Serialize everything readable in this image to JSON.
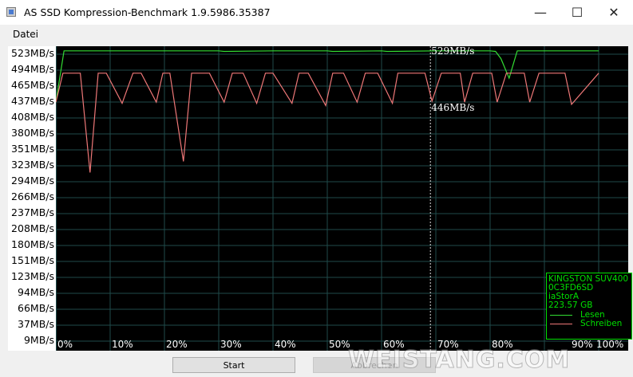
{
  "window": {
    "title": "AS SSD Kompression-Benchmark 1.9.5986.35387",
    "minimize_glyph": "—",
    "maximize_glyph": "☐",
    "close_glyph": "✕"
  },
  "menu": {
    "items": [
      "Datei"
    ]
  },
  "chart_data": {
    "type": "line",
    "y_tick_labels": [
      "523MB/s",
      "494MB/s",
      "465MB/s",
      "437MB/s",
      "408MB/s",
      "380MB/s",
      "351MB/s",
      "323MB/s",
      "294MB/s",
      "266MB/s",
      "237MB/s",
      "208MB/s",
      "180MB/s",
      "151MB/s",
      "123MB/s",
      "94MB/s",
      "66MB/s",
      "37MB/s",
      "9MB/s"
    ],
    "x_tick_labels": [
      "0%",
      "10%",
      "20%",
      "30%",
      "40%",
      "50%",
      "60%",
      "70%",
      "80%",
      "90%",
      "100%"
    ],
    "x_unit": "%",
    "y_unit": "MB/s",
    "xlim": [
      0,
      100
    ],
    "ylim": [
      0,
      537
    ],
    "grid": true,
    "legend_placement": "bottom-right",
    "cursor_x": 69,
    "series": [
      {
        "name": "Lesen",
        "color": "#33dd33",
        "x": [
          0,
          1.5,
          30,
          31,
          40,
          50,
          51,
          60,
          61,
          70,
          80,
          81,
          82,
          83.5,
          85,
          100
        ],
        "y": [
          437,
          529,
          529,
          528,
          529,
          529,
          528,
          529,
          528,
          529,
          529,
          528,
          515,
          480,
          529,
          529
        ]
      },
      {
        "name": "Schreiben",
        "color": "#ee7777",
        "x": [
          0,
          1.3,
          4.5,
          6.3,
          7.8,
          9.3,
          12.2,
          14.2,
          15.7,
          18.5,
          19.7,
          21,
          23.5,
          25,
          26.5,
          28.3,
          31,
          32.5,
          34.5,
          37,
          38.6,
          40,
          43.5,
          44.8,
          46.5,
          49.7,
          51,
          53,
          55.5,
          57,
          59.3,
          62,
          63,
          65,
          68,
          69.3,
          71,
          74.5,
          75.3,
          76.8,
          80.3,
          81.3,
          83,
          86.3,
          87.3,
          89,
          93.8,
          95,
          100
        ],
        "y": [
          437,
          489,
          489,
          311,
          489,
          489,
          435,
          489,
          489,
          437,
          489,
          489,
          331,
          489,
          489,
          489,
          437,
          489,
          489,
          435,
          489,
          489,
          435,
          489,
          489,
          431,
          489,
          489,
          437,
          489,
          489,
          435,
          489,
          489,
          489,
          439,
          489,
          489,
          437,
          489,
          489,
          437,
          489,
          489,
          437,
          489,
          489,
          433,
          489
        ]
      }
    ],
    "annotations": [
      {
        "text": "529MB/s",
        "series": "Lesen",
        "x": 69,
        "y": 529
      },
      {
        "text": "446MB/s",
        "series": "Schreiben",
        "x": 69,
        "y": 446
      }
    ]
  },
  "legend": {
    "drive": "KINGSTON SUV400",
    "firmware": "0C3FD6SD",
    "driver": "iaStorA",
    "capacity": "223.57 GB",
    "series_labels": [
      "Lesen",
      "Schreiben"
    ]
  },
  "buttons": {
    "start_label": "Start",
    "abort_label": "Abbrechen"
  },
  "watermark": "WEISTANG.COM"
}
